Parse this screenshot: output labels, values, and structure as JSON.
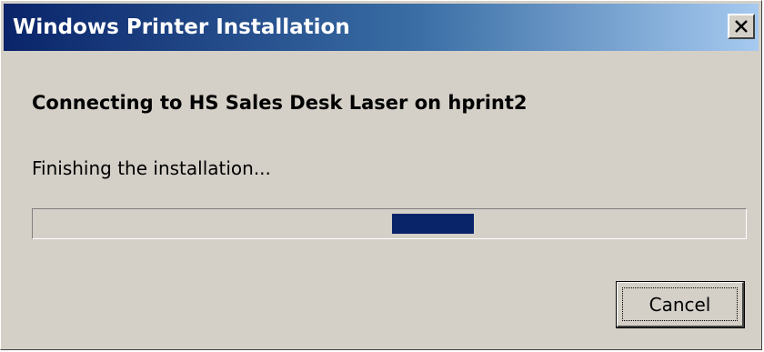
{
  "window": {
    "title": "Windows Printer Installation"
  },
  "content": {
    "heading": "Connecting to HS Sales Desk Laser on hprint2",
    "status_text": "Finishing the installation..."
  },
  "buttons": {
    "cancel_label": "Cancel"
  },
  "icons": {
    "close": "close-icon"
  },
  "colors": {
    "title_start": "#0a246a",
    "title_end": "#a6caf0",
    "dialog_bg": "#d4d0c8",
    "progress_chunk": "#0a246a"
  }
}
